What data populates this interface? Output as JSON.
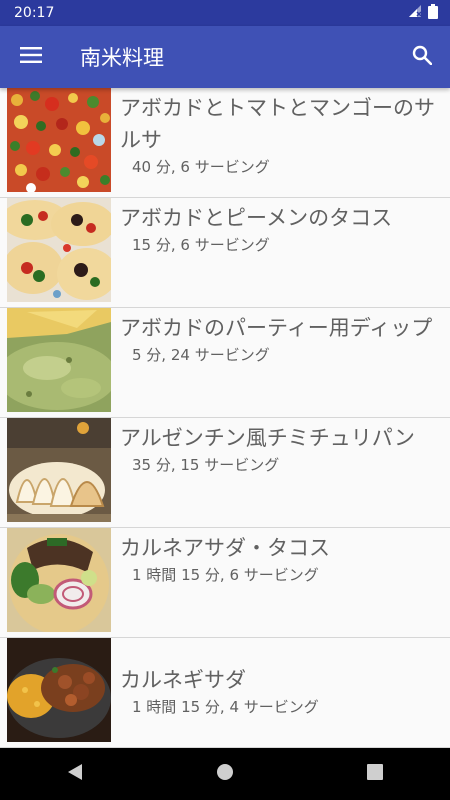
{
  "status_bar": {
    "time": "20:17",
    "icons": [
      "signal-icon",
      "battery-icon"
    ]
  },
  "app_bar": {
    "title": "南米料理",
    "menu_icon": "menu-icon",
    "search_icon": "search-icon"
  },
  "recipes": [
    {
      "title": "アボカドとトマトとマンゴーのサルサ",
      "meta": "40 分, 6 サービング"
    },
    {
      "title": "アボカドとピーメンのタコス",
      "meta": "15 分, 6 サービング"
    },
    {
      "title": "アボカドのパーティー用ディップ",
      "meta": "5 分, 24 サービング"
    },
    {
      "title": "アルゼンチン風チミチュリパン",
      "meta": "35 分, 15 サービング"
    },
    {
      "title": "カルネアサダ・タコス",
      "meta": "1 時間 15 分, 6 サービング"
    },
    {
      "title": "カルネギサダ",
      "meta": "1 時間 15 分, 4 サービング"
    }
  ],
  "nav_bar": {
    "back_icon": "back-icon",
    "home_icon": "home-icon",
    "recents_icon": "recents-icon"
  },
  "colors": {
    "primary": "#3f51b5",
    "primary_dark": "#2c3a9e",
    "text": "#616161"
  }
}
